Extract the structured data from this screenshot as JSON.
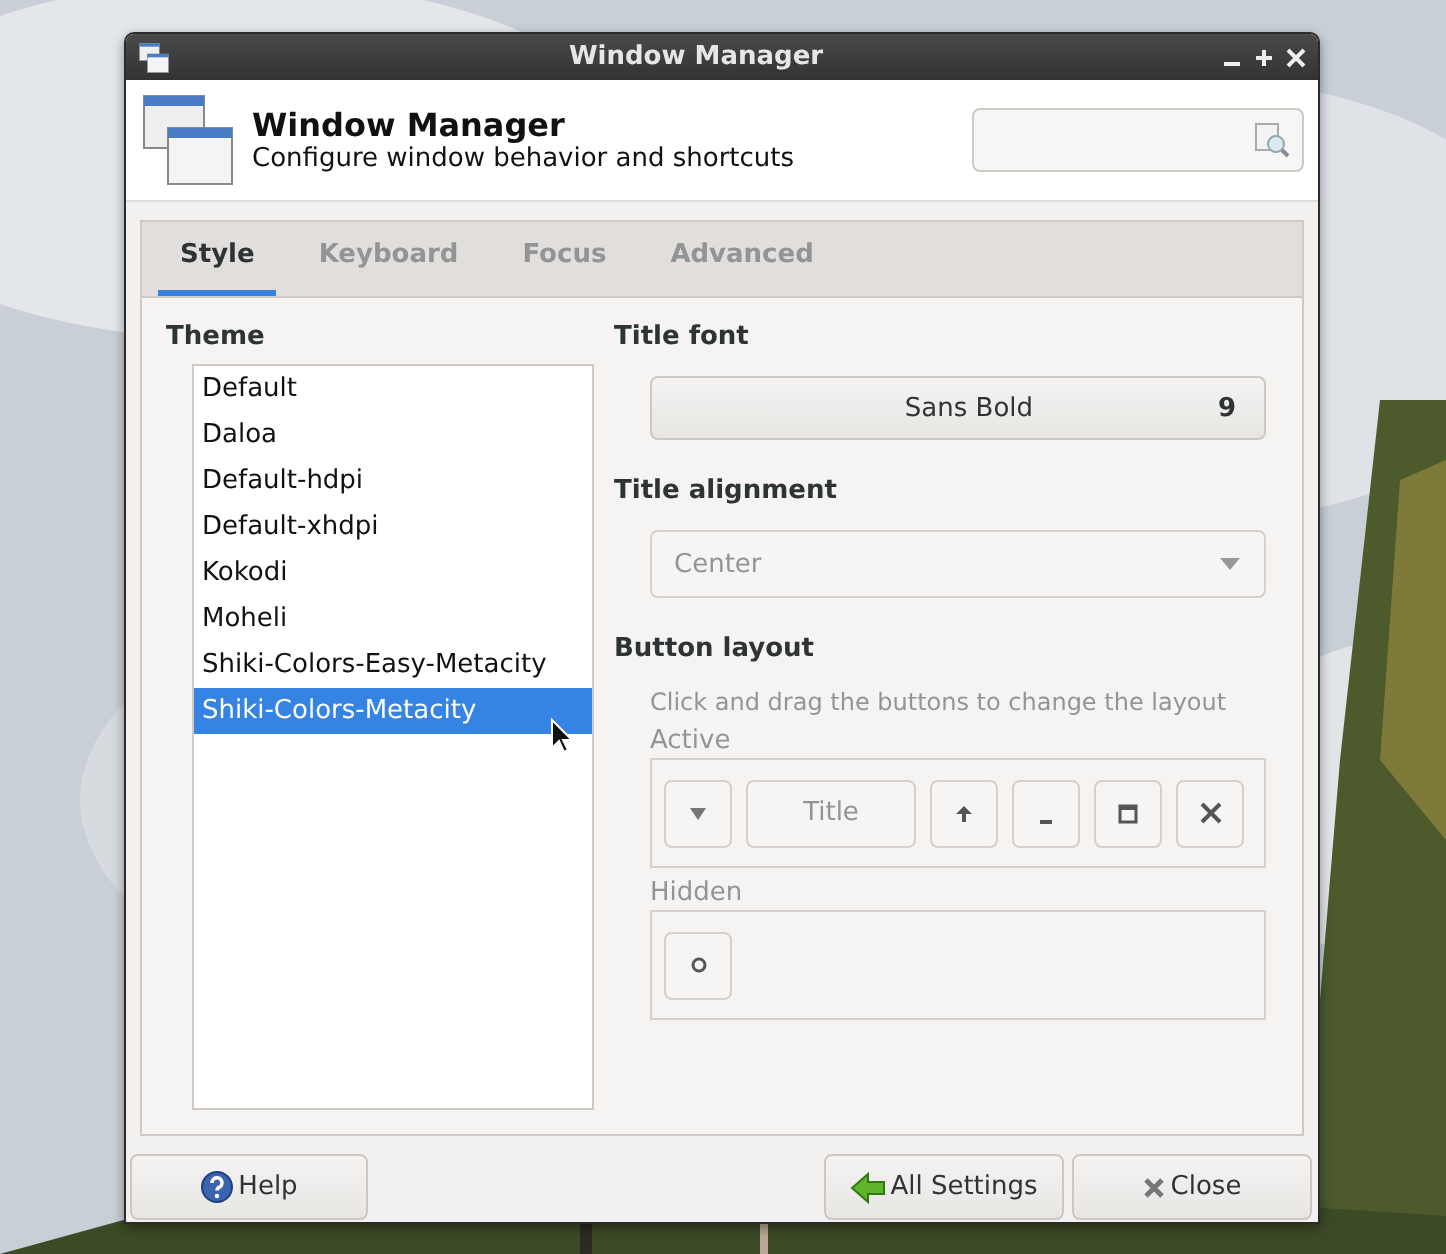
{
  "window": {
    "title": "Window Manager"
  },
  "header": {
    "title": "Window Manager",
    "subtitle": "Configure window behavior and shortcuts"
  },
  "tabs": [
    {
      "label": "Style",
      "selected": true
    },
    {
      "label": "Keyboard",
      "selected": false
    },
    {
      "label": "Focus",
      "selected": false
    },
    {
      "label": "Advanced",
      "selected": false
    }
  ],
  "theme": {
    "label": "Theme",
    "items": [
      {
        "name": "Default",
        "selected": false
      },
      {
        "name": "Daloa",
        "selected": false
      },
      {
        "name": "Default-hdpi",
        "selected": false
      },
      {
        "name": "Default-xhdpi",
        "selected": false
      },
      {
        "name": "Kokodi",
        "selected": false
      },
      {
        "name": "Moheli",
        "selected": false
      },
      {
        "name": "Shiki-Colors-Easy-Metacity",
        "selected": false
      },
      {
        "name": "Shiki-Colors-Metacity",
        "selected": true
      }
    ]
  },
  "title_font": {
    "label": "Title font",
    "font": "Sans Bold",
    "size": "9"
  },
  "title_alignment": {
    "label": "Title alignment",
    "value": "Center",
    "disabled": true
  },
  "button_layout": {
    "label": "Button layout",
    "hint": "Click and drag the buttons to change the layout",
    "active": {
      "label": "Active",
      "buttons": [
        {
          "kind": "menu"
        },
        {
          "kind": "title",
          "label": "Title"
        },
        {
          "kind": "shade"
        },
        {
          "kind": "minimize"
        },
        {
          "kind": "maximize"
        },
        {
          "kind": "close"
        }
      ]
    },
    "hidden": {
      "label": "Hidden",
      "buttons": [
        {
          "kind": "stick"
        }
      ]
    }
  },
  "footer": {
    "help": "Help",
    "all_settings": "All Settings",
    "close": "Close"
  }
}
